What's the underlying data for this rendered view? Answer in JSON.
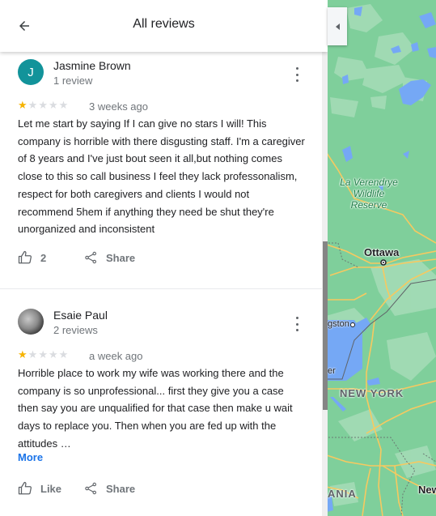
{
  "header": {
    "title": "All reviews",
    "back_icon": "arrow-left-icon"
  },
  "map": {
    "collapse_icon": "triangle-left-icon",
    "labels": {
      "reserve": [
        "La Verendrye",
        "Wildlife",
        "Reserve"
      ],
      "ottawa": "Ottawa",
      "kingston": "gston",
      "lake": "er",
      "new_york": "NEW YORK",
      "pennsylvania": "ANIA",
      "new_jersey": "New"
    },
    "colors": {
      "land": "#7fcf9b",
      "water": "#75a8f5",
      "road": "#f7c960"
    }
  },
  "reviews": [
    {
      "author": "Jasmine Brown",
      "avatar_letter": "J",
      "avatar_color": "#12939a",
      "sub": "1 review",
      "rating": 1,
      "max_rating": 5,
      "date": "3 weeks ago",
      "text": "Let me start by saying If I can give no stars I will! This company is horrible with there disgusting staff. I'm a caregiver of 8 years and I've just bout seen it all,but nothing comes close to this so call business I feel they lack professonalism, respect for both caregivers and clients I would not recommend 5hem if anything they need be shut they're unorganized and inconsistent",
      "like_label": "2",
      "share_label": "Share"
    },
    {
      "author": "Esaie Paul",
      "sub": "2 reviews",
      "rating": 1,
      "max_rating": 5,
      "date": "a week ago",
      "text": "Horrible place to work my wife was working there and the company is so unprofessional... first they give you a case then say you are unqualified for that case then make u wait days to replace you. Then when you are fed up with the attitudes …",
      "more_label": "More",
      "like_label": "Like",
      "share_label": "Share"
    }
  ],
  "colors": {
    "star_on": "#f6b300",
    "star_off": "#dadce0",
    "link": "#1a73e8"
  }
}
